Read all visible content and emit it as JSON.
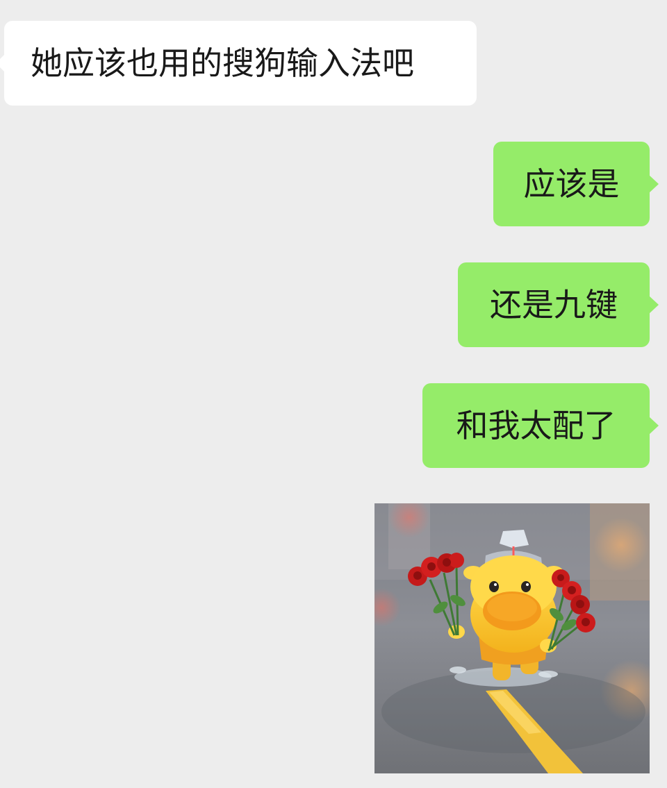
{
  "messages": [
    {
      "side": "incoming",
      "text": "她应该也用的搜狗输入法吧"
    },
    {
      "side": "outgoing",
      "text": "应该是"
    },
    {
      "side": "outgoing",
      "text": "还是九键"
    },
    {
      "side": "outgoing",
      "text": "和我太配了"
    },
    {
      "side": "outgoing",
      "type": "sticker",
      "icon": "yellow-cartoon-character-holding-roses-sticker"
    }
  ],
  "colors": {
    "background": "#ededed",
    "incoming_bubble": "#ffffff",
    "outgoing_bubble": "#95ec69",
    "text": "#191919"
  }
}
